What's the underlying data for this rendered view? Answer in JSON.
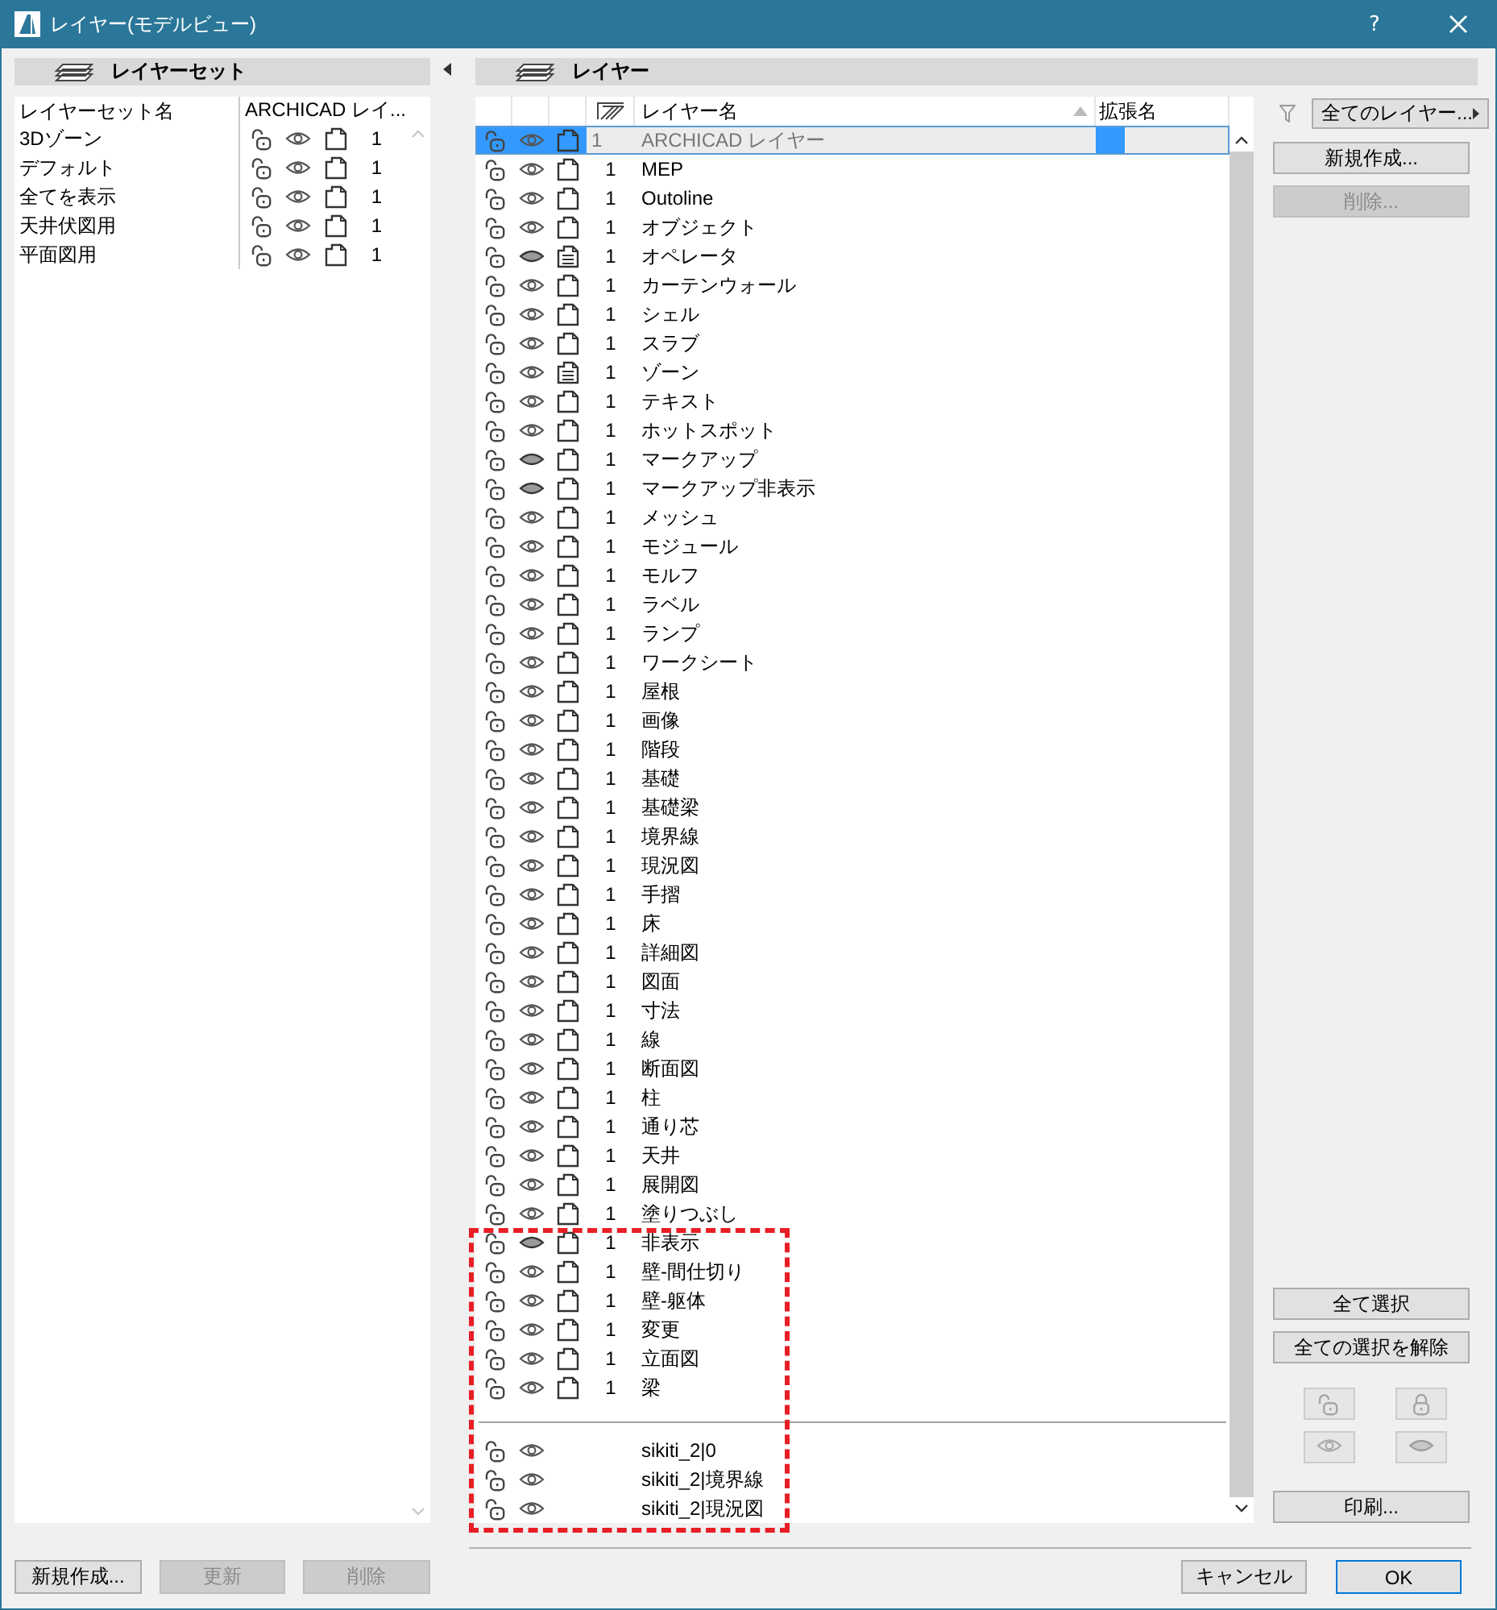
{
  "window": {
    "title": "レイヤー(モデルビュー)",
    "help": "?"
  },
  "layer_sets": {
    "title": "レイヤーセット",
    "columns": [
      "レイヤーセット名",
      "ARCHICAD レイ..."
    ],
    "rows": [
      {
        "name": "3Dゾーン",
        "count": "1"
      },
      {
        "name": "デフォルト",
        "count": "1"
      },
      {
        "name": "全てを表示",
        "count": "1"
      },
      {
        "name": "天井伏図用",
        "count": "1"
      },
      {
        "name": "平面図用",
        "count": "1"
      }
    ],
    "buttons": [
      {
        "label": "新規作成...",
        "disabled": false
      },
      {
        "label": "更新",
        "disabled": true
      },
      {
        "label": "削除",
        "disabled": true
      }
    ]
  },
  "layers": {
    "title": "レイヤー",
    "columns": [
      "レイヤー名",
      "拡張名"
    ],
    "sort_ascending": true,
    "rows": [
      {
        "name": "ARCHICAD レイヤー",
        "count": "1",
        "selected": true,
        "visible": true,
        "solid": false
      },
      {
        "name": "MEP",
        "count": "1",
        "selected": false,
        "visible": true,
        "solid": false
      },
      {
        "name": "Outoline",
        "count": "1",
        "selected": false,
        "visible": true,
        "solid": false
      },
      {
        "name": "オブジェクト",
        "count": "1",
        "selected": false,
        "visible": true,
        "solid": false
      },
      {
        "name": "オペレータ",
        "count": "1",
        "selected": false,
        "visible": false,
        "solid": true
      },
      {
        "name": "カーテンウォール",
        "count": "1",
        "selected": false,
        "visible": true,
        "solid": false
      },
      {
        "name": "シェル",
        "count": "1",
        "selected": false,
        "visible": true,
        "solid": false
      },
      {
        "name": "スラブ",
        "count": "1",
        "selected": false,
        "visible": true,
        "solid": false
      },
      {
        "name": "ゾーン",
        "count": "1",
        "selected": false,
        "visible": true,
        "solid": true
      },
      {
        "name": "テキスト",
        "count": "1",
        "selected": false,
        "visible": true,
        "solid": false
      },
      {
        "name": "ホットスポット",
        "count": "1",
        "selected": false,
        "visible": true,
        "solid": false
      },
      {
        "name": "マークアップ",
        "count": "1",
        "selected": false,
        "visible": false,
        "solid": false
      },
      {
        "name": "マークアップ非表示",
        "count": "1",
        "selected": false,
        "visible": false,
        "solid": false
      },
      {
        "name": "メッシュ",
        "count": "1",
        "selected": false,
        "visible": true,
        "solid": false
      },
      {
        "name": "モジュール",
        "count": "1",
        "selected": false,
        "visible": true,
        "solid": false
      },
      {
        "name": "モルフ",
        "count": "1",
        "selected": false,
        "visible": true,
        "solid": false
      },
      {
        "name": "ラベル",
        "count": "1",
        "selected": false,
        "visible": true,
        "solid": false
      },
      {
        "name": "ランプ",
        "count": "1",
        "selected": false,
        "visible": true,
        "solid": false
      },
      {
        "name": "ワークシート",
        "count": "1",
        "selected": false,
        "visible": true,
        "solid": false
      },
      {
        "name": "屋根",
        "count": "1",
        "selected": false,
        "visible": true,
        "solid": false
      },
      {
        "name": "画像",
        "count": "1",
        "selected": false,
        "visible": true,
        "solid": false
      },
      {
        "name": "階段",
        "count": "1",
        "selected": false,
        "visible": true,
        "solid": false
      },
      {
        "name": "基礎",
        "count": "1",
        "selected": false,
        "visible": true,
        "solid": false
      },
      {
        "name": "基礎梁",
        "count": "1",
        "selected": false,
        "visible": true,
        "solid": false
      },
      {
        "name": "境界線",
        "count": "1",
        "selected": false,
        "visible": true,
        "solid": false
      },
      {
        "name": "現況図",
        "count": "1",
        "selected": false,
        "visible": true,
        "solid": false
      },
      {
        "name": "手摺",
        "count": "1",
        "selected": false,
        "visible": true,
        "solid": false
      },
      {
        "name": "床",
        "count": "1",
        "selected": false,
        "visible": true,
        "solid": false
      },
      {
        "name": "詳細図",
        "count": "1",
        "selected": false,
        "visible": true,
        "solid": false
      },
      {
        "name": "図面",
        "count": "1",
        "selected": false,
        "visible": true,
        "solid": false
      },
      {
        "name": "寸法",
        "count": "1",
        "selected": false,
        "visible": true,
        "solid": false
      },
      {
        "name": "線",
        "count": "1",
        "selected": false,
        "visible": true,
        "solid": false
      },
      {
        "name": "断面図",
        "count": "1",
        "selected": false,
        "visible": true,
        "solid": false
      },
      {
        "name": "柱",
        "count": "1",
        "selected": false,
        "visible": true,
        "solid": false
      },
      {
        "name": "通り芯",
        "count": "1",
        "selected": false,
        "visible": true,
        "solid": false
      },
      {
        "name": "天井",
        "count": "1",
        "selected": false,
        "visible": true,
        "solid": false
      },
      {
        "name": "展開図",
        "count": "1",
        "selected": false,
        "visible": true,
        "solid": false
      },
      {
        "name": "塗りつぶし",
        "count": "1",
        "selected": false,
        "visible": true,
        "solid": false
      },
      {
        "name": "非表示",
        "count": "1",
        "selected": false,
        "visible": false,
        "solid": false
      },
      {
        "name": "壁-間仕切り",
        "count": "1",
        "selected": false,
        "visible": true,
        "solid": false
      },
      {
        "name": "壁-躯体",
        "count": "1",
        "selected": false,
        "visible": true,
        "solid": false
      },
      {
        "name": "変更",
        "count": "1",
        "selected": false,
        "visible": true,
        "solid": false
      },
      {
        "name": "立面図",
        "count": "1",
        "selected": false,
        "visible": true,
        "solid": false
      },
      {
        "name": "梁",
        "count": "1",
        "selected": false,
        "visible": true,
        "solid": false
      }
    ],
    "xref_rows": [
      {
        "name": "sikiti_2|0",
        "visible": true
      },
      {
        "name": "sikiti_2|境界線",
        "visible": true
      },
      {
        "name": "sikiti_2|現況図",
        "visible": true
      }
    ]
  },
  "filter": {
    "label": "全てのレイヤー..."
  },
  "side_buttons": [
    {
      "label": "新規作成...",
      "disabled": false
    },
    {
      "label": "削除...",
      "disabled": true
    }
  ],
  "selection_buttons": [
    {
      "label": "全て選択"
    },
    {
      "label": "全ての選択を解除"
    }
  ],
  "toggle_buttons": [
    {
      "kind": "unlock",
      "disabled": true
    },
    {
      "kind": "lock",
      "disabled": true
    },
    {
      "kind": "show",
      "disabled": true
    },
    {
      "kind": "hide",
      "disabled": true
    }
  ],
  "print_button": {
    "label": "印刷..."
  },
  "footer_buttons": [
    {
      "label": "キャンセル",
      "default": false
    },
    {
      "label": "OK",
      "default": true
    }
  ],
  "annotation": {
    "kind": "dashed-frame"
  }
}
